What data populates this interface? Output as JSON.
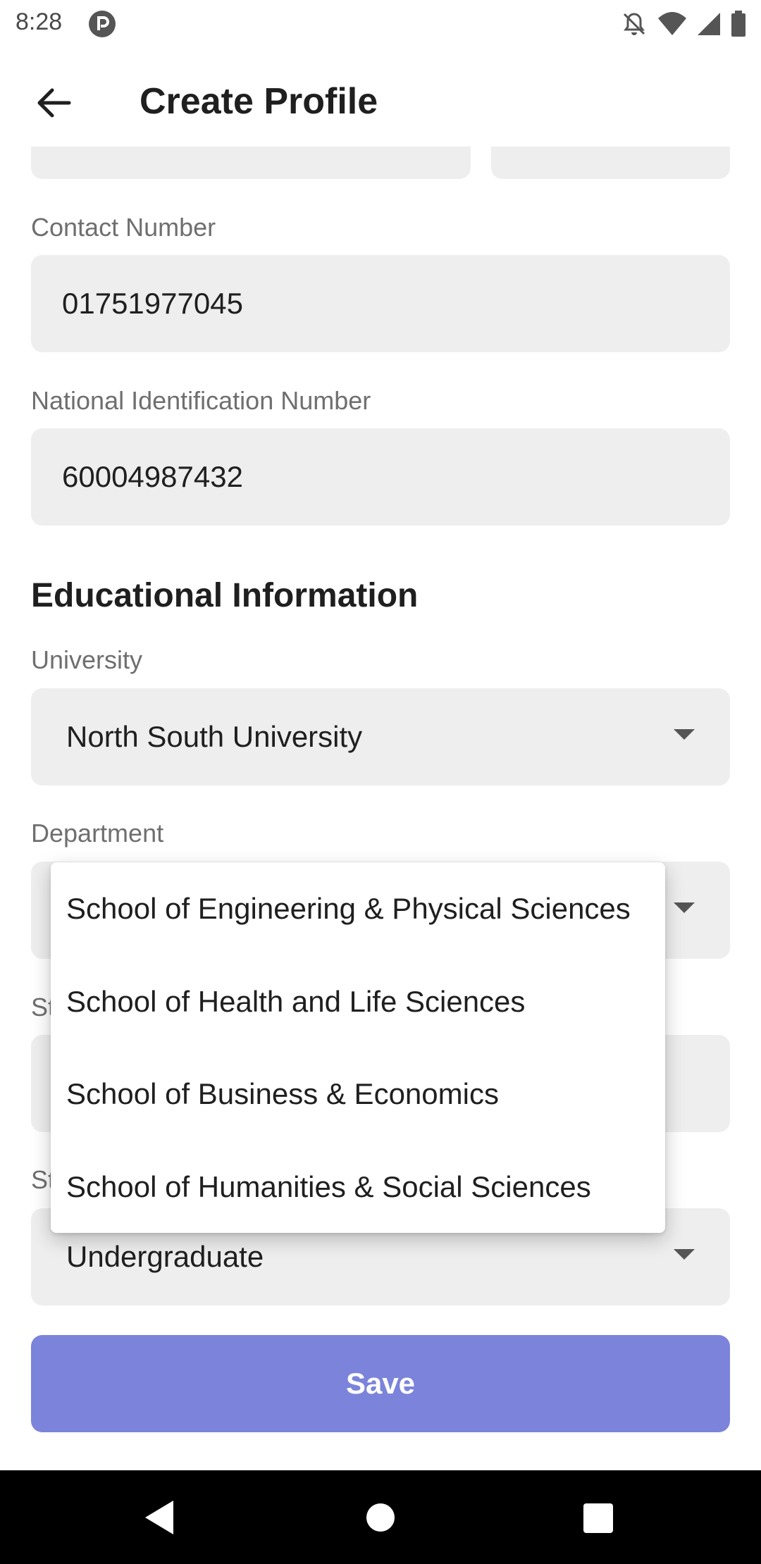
{
  "status_bar": {
    "time": "8:28",
    "app_icon": "p-circle-icon",
    "icons": [
      "bell-off-icon",
      "wifi-icon",
      "signal-icon",
      "battery-icon"
    ]
  },
  "app_bar": {
    "title": "Create Profile",
    "back_icon": "arrow-left-icon"
  },
  "contact": {
    "label": "Contact Number",
    "value": "01751977045"
  },
  "nid": {
    "label": "National Identification Number",
    "value": "60004987432"
  },
  "education": {
    "heading": "Educational Information",
    "university": {
      "label": "University",
      "value": "North South University"
    },
    "department": {
      "label": "Department"
    },
    "hidden_label_1_fragment": "St",
    "hidden_label_2_fragment": "St",
    "student_type_value": "Undergraduate"
  },
  "dropdown": {
    "options": [
      "School of Engineering & Physical Sciences",
      "School of Health and Life Sciences",
      "School of Business & Economics",
      "School of Humanities & Social Sciences"
    ]
  },
  "actions": {
    "save_label": "Save"
  },
  "colors": {
    "primary_button": "#7b84da",
    "field_bg": "#eeeeee",
    "nav_bar": "#000000"
  }
}
